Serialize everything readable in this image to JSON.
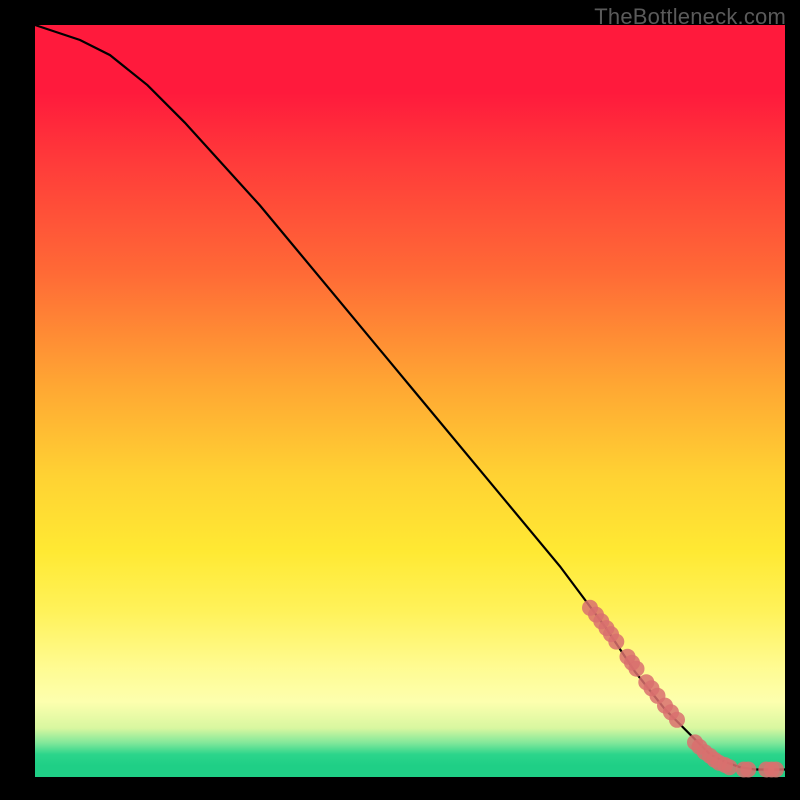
{
  "watermark": "TheBottleneck.com",
  "chart_data": {
    "type": "line",
    "title": "",
    "xlabel": "",
    "ylabel": "",
    "xlim": [
      0,
      100
    ],
    "ylim": [
      0,
      100
    ],
    "grid": false,
    "legend": false,
    "series": [
      {
        "name": "curve",
        "style": "line",
        "color": "#000000",
        "x": [
          0,
          3,
          6,
          10,
          15,
          20,
          30,
          40,
          50,
          60,
          70,
          76,
          80,
          84,
          88,
          90,
          92,
          94,
          96,
          98,
          100
        ],
        "y": [
          100,
          99,
          98,
          96,
          92,
          87,
          76,
          64,
          52,
          40,
          28,
          20,
          14,
          9,
          5,
          3,
          2,
          1.3,
          1,
          1,
          1
        ]
      },
      {
        "name": "points",
        "style": "scatter",
        "color": "#d9706e",
        "x": [
          74,
          74.8,
          75.5,
          76.2,
          76.8,
          77.5,
          79,
          79.6,
          80.2,
          81.5,
          82.2,
          83,
          84,
          84.8,
          85.6,
          88,
          88.6,
          89.3,
          90,
          90.6,
          91.2,
          92,
          92.6,
          94.5,
          95.1,
          97.5,
          98.2,
          98.8
        ],
        "y": [
          22.5,
          21.6,
          20.7,
          19.8,
          19,
          18,
          16,
          15.2,
          14.4,
          12.6,
          11.8,
          10.8,
          9.5,
          8.6,
          7.6,
          4.6,
          4,
          3.3,
          2.8,
          2.3,
          1.9,
          1.6,
          1.3,
          1,
          1,
          1,
          1,
          1
        ]
      }
    ]
  }
}
